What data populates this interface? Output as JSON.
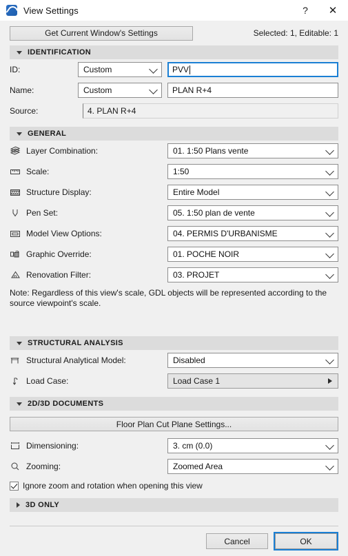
{
  "window": {
    "title": "View Settings",
    "logo_icon": "archicad-logo-icon",
    "help_label": "?",
    "close_label": "✕"
  },
  "toolbar": {
    "get_settings_label": "Get Current Window's Settings",
    "selection_status": "Selected: 1, Editable: 1"
  },
  "sections": {
    "identification": {
      "title": "IDENTIFICATION",
      "expanded": true,
      "id_label": "ID:",
      "id_mode": "Custom",
      "id_value": "PVV",
      "name_label": "Name:",
      "name_mode": "Custom",
      "name_value": "PLAN R+4",
      "source_label": "Source:",
      "source_value": "4. PLAN R+4"
    },
    "general": {
      "title": "GENERAL",
      "expanded": true,
      "rows": [
        {
          "icon": "layers-icon",
          "label": "Layer Combination:",
          "value": "01. 1:50 Plans vente"
        },
        {
          "icon": "ruler-icon",
          "label": "Scale:",
          "value": "1:50"
        },
        {
          "icon": "structure-display-icon",
          "label": "Structure Display:",
          "value": "Entire Model"
        },
        {
          "icon": "pen-set-icon",
          "label": "Pen Set:",
          "value": "05. 1:50 plan de vente"
        },
        {
          "icon": "model-view-options-icon",
          "label": "Model View Options:",
          "value": "04. PERMIS D'URBANISME"
        },
        {
          "icon": "graphic-override-icon",
          "label": "Graphic Override:",
          "value": "01. POCHE NOIR"
        },
        {
          "icon": "renovation-filter-icon",
          "label": "Renovation Filter:",
          "value": "03. PROJET"
        }
      ],
      "note": "Note: Regardless of this view's scale, GDL objects will be represented according to the source viewpoint's scale."
    },
    "structural_analysis": {
      "title": "STRUCTURAL ANALYSIS",
      "expanded": true,
      "model_icon": "structural-analytical-model-icon",
      "model_label": "Structural Analytical Model:",
      "model_value": "Disabled",
      "load_case_icon": "load-case-icon",
      "load_case_label": "Load Case:",
      "load_case_value": "Load Case 1"
    },
    "documents_2d3d": {
      "title": "2D/3D DOCUMENTS",
      "expanded": true,
      "cut_plane_button": "Floor Plan Cut Plane Settings...",
      "dimensioning_icon": "dimensioning-icon",
      "dimensioning_label": "Dimensioning:",
      "dimensioning_value": "3. cm (0.0)",
      "zooming_icon": "magnifier-icon",
      "zooming_label": "Zooming:",
      "zooming_value": "Zoomed Area",
      "ignore_zoom_label": "Ignore zoom and rotation when opening this view",
      "ignore_zoom_checked": true
    },
    "three_d_only": {
      "title": "3D ONLY",
      "expanded": false
    }
  },
  "footer": {
    "cancel_label": "Cancel",
    "ok_label": "OK"
  },
  "colors": {
    "accent": "#1a7fd4",
    "section_header_bg": "#dcdcdc",
    "window_bg": "#f0f0f0"
  }
}
